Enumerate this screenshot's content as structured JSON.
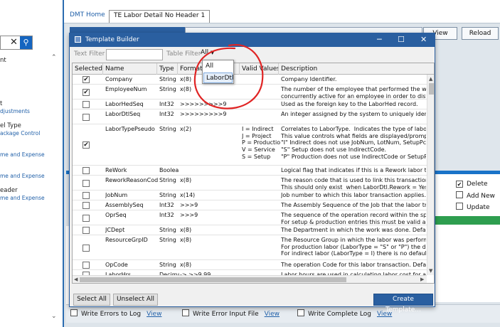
{
  "app": {
    "tabs": {
      "home": "DMT Home",
      "active": "TE Labor Detail No Header 1"
    },
    "view_button": "View",
    "reload_button": "Reload",
    "left_nav": {
      "line1": "nt",
      "line2": "t",
      "line3": "djustments",
      "line4": "el Type",
      "line5": "ackage Control",
      "line6": "me and Expense",
      "line7": "me and Expense",
      "line8": "eader",
      "line9": "me and Expense"
    },
    "right_options": {
      "delete": "Delete",
      "add_new": "Add New",
      "update": "Update"
    },
    "bottom": {
      "write_errors": "Write Errors to Log",
      "write_error_input": "Write Error Input File",
      "write_complete": "Write Complete Log",
      "view": "View"
    }
  },
  "dialog": {
    "title": "Template Builder",
    "text_filter_label": "Text Filter",
    "table_filter_label": "Table Filter",
    "table_filter_value": "All",
    "dropdown_options": [
      "All",
      "LaborDtl"
    ],
    "columns": [
      "Selected",
      "Name",
      "Type",
      "Format",
      "Valid Values",
      "Description"
    ],
    "rows": [
      {
        "checked": true,
        "name": "Company",
        "type": "String",
        "format": "x(8)",
        "valid": "",
        "desc": "Company Identifier."
      },
      {
        "checked": true,
        "name": "EmployeeNum",
        "type": "String",
        "format": "x(8)",
        "valid": "",
        "desc": "The number of the employee that performed the work. This\nconcurrently active for an employee in order to distribute t"
      },
      {
        "checked": false,
        "name": "LaborHedSeq",
        "type": "Int32",
        "format": ">>>>>>>>>9",
        "valid": "",
        "desc": "Used as the foreign key to the LaborHed record."
      },
      {
        "checked": false,
        "name": "LaborDtlSeq",
        "type": "Int32",
        "format": ">>>>>>>>>9",
        "valid": "",
        "desc": "An integer assigned by the system to uniquely identify the"
      },
      {
        "checked": true,
        "name": "LaborTypePseudo",
        "type": "String",
        "format": "x(2)",
        "valid": "I = Indirect\nJ = Project\nP = Production\nV = Service\nS = Setup",
        "desc": "Correlates to LaborType.  Indicates the type of labor transa\nThis value controls what fields are displayed/prompted for.\n\"I\" Indirect does not use JobNum, LotNum, SetupPctCmp, (\n\"S\" Setup does not use IndirectCode.\n\"P\" Production does not use IndirectCode or SetupPctCmp,"
      },
      {
        "checked": false,
        "name": "ReWork",
        "type": "Boolean",
        "format": "",
        "valid": "",
        "desc": "Logical flag that indicates if this is a Rework labor transactic"
      },
      {
        "checked": false,
        "name": "ReworkReasonCode",
        "type": "String",
        "format": "x(8)",
        "valid": "",
        "desc": "The reason code that is used to link this transaction to a Re\nThis should only exist  when LaborDtl.Rework = Yes."
      },
      {
        "checked": false,
        "name": "JobNum",
        "type": "String",
        "format": "x(14)",
        "valid": "",
        "desc": "Job number to which this labor transaction applies. For Set"
      },
      {
        "checked": false,
        "name": "AssemblySeq",
        "type": "Int32",
        "format": ">>>9",
        "valid": "",
        "desc": "The Assembly Sequence of the Job that the labor transactio"
      },
      {
        "checked": false,
        "name": "OprSeq",
        "type": "Int32",
        "format": ">>>9",
        "valid": "",
        "desc": "The sequence of the operation record within the specific Jc\nFor setup & production entries this must be valid and must"
      },
      {
        "checked": false,
        "name": "JCDept",
        "type": "String",
        "format": "x(8)",
        "valid": "",
        "desc": "The Department in which the work was done. Default is fro"
      },
      {
        "checked": false,
        "name": "ResourceGrpID",
        "type": "String",
        "format": "x(8)",
        "valid": "",
        "desc": "The Resource Group in which the labor was performed.  Th\nFor production labor (LaborType = \"S\" or \"P\") the default is\nFor indirect labor (LaborType = I) there is no default."
      },
      {
        "checked": false,
        "name": "OpCode",
        "type": "String",
        "format": "x(8)",
        "valid": "",
        "desc": "The operation Code for this labor transaction. Default from"
      },
      {
        "checked": false,
        "name": "LaborHrs",
        "type": "Decimal",
        "format": "->,>>9.99",
        "valid": "",
        "desc": "Labor hours are used in calculating labor cost for a job. It is"
      }
    ],
    "select_all": "Select All",
    "unselect_all": "Unselect All",
    "create_template": "Create Template..."
  }
}
